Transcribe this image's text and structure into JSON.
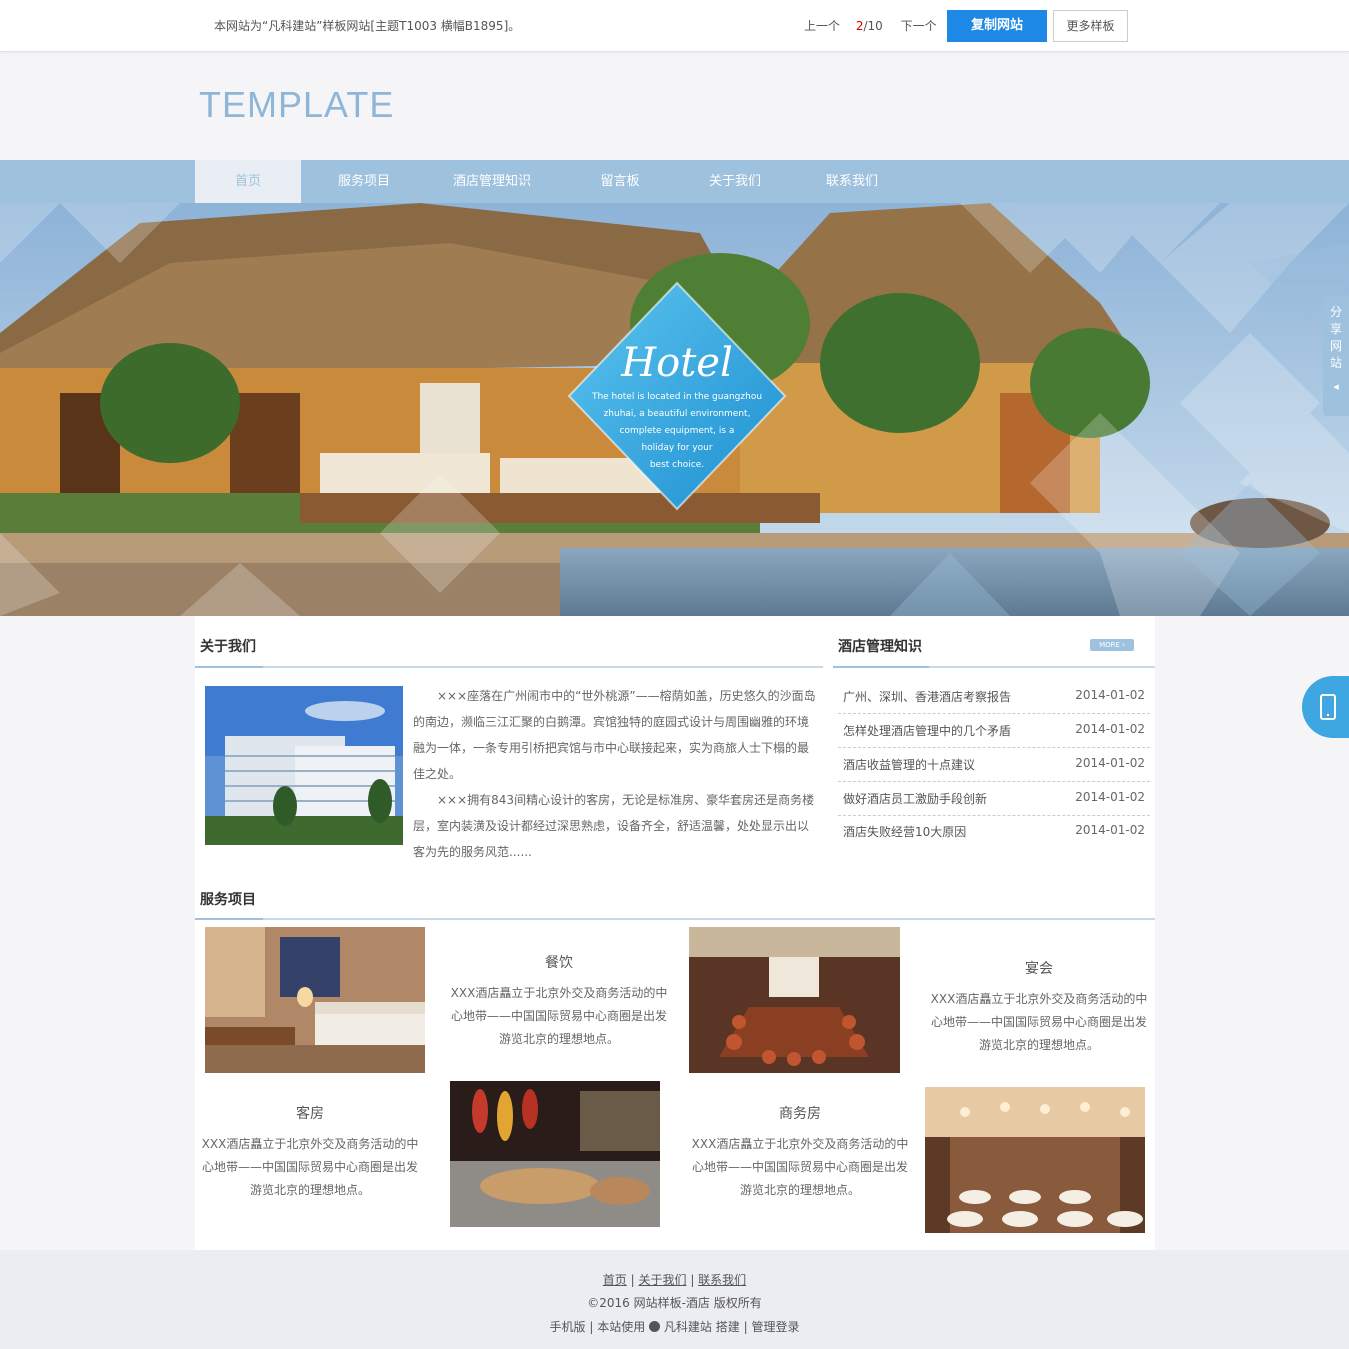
{
  "topbar": {
    "notice": "本网站为“凡科建站”样板网站[主题T1003 横幅B1895]。",
    "prev": "上一个",
    "page_current": "2",
    "page_total": "/10",
    "next": "下一个",
    "copy_btn": "复制网站",
    "more_btn": "更多样板"
  },
  "logo": "TEMPLATE",
  "nav": [
    "首页",
    "服务项目",
    "酒店管理知识",
    "留言板",
    "关于我们",
    "联系我们"
  ],
  "banner": {
    "badge_title": "Hotel",
    "badge_lines": [
      "The hotel is located in the guangzhou",
      "zhuhai, a beautiful environment,",
      "complete equipment, is a",
      "holiday for your",
      "best choice."
    ]
  },
  "share_label": "分享网站",
  "about": {
    "title": "关于我们",
    "p1": "×××座落在广州闹市中的“世外桃源”——榕荫如盖，历史悠久的沙面岛的南边，濒临三江汇聚的白鹅潭。宾馆独特的庭园式设计与周围幽雅的环境融为一体，一条专用引桥把宾馆与市中心联接起来，实为商旅人士下榻的最佳之处。",
    "p2": "×××拥有843间精心设计的客房，无论是标准房、豪华套房还是商务楼层，室内装潢及设计都经过深思熟虑，设备齐全，舒适温馨，处处显示出以客为先的服务风范......"
  },
  "news": {
    "title": "酒店管理知识",
    "more": "MORE ›",
    "items": [
      {
        "title": "广州、深圳、香港酒店考察报告",
        "date": "2014-01-02"
      },
      {
        "title": "怎样处理酒店管理中的几个矛盾",
        "date": "2014-01-02"
      },
      {
        "title": "酒店收益管理的十点建议",
        "date": "2014-01-02"
      },
      {
        "title": "做好酒店员工激励手段创新",
        "date": "2014-01-02"
      },
      {
        "title": "酒店失败经营10大原因",
        "date": "2014-01-02"
      }
    ]
  },
  "services": {
    "title": "服务项目",
    "items": [
      {
        "name": "餐饮",
        "desc": "XXX酒店矗立于北京外交及商务活动的中心地带——中国国际贸易中心商圈是出发游览北京的理想地点。"
      },
      {
        "name": "宴会",
        "desc": "XXX酒店矗立于北京外交及商务活动的中心地带——中国国际贸易中心商圈是出发游览北京的理想地点。"
      },
      {
        "name": "客房",
        "desc": "XXX酒店矗立于北京外交及商务活动的中心地带——中国国际贸易中心商圈是出发游览北京的理想地点。"
      },
      {
        "name": "商务房",
        "desc": "XXX酒店矗立于北京外交及商务活动的中心地带——中国国际贸易中心商圈是出发游览北京的理想地点。"
      }
    ]
  },
  "footer": {
    "links": [
      "首页",
      "关于我们",
      "联系我们"
    ],
    "copyright": "©2016 网站样板-酒店 版权所有",
    "mobile": "手机版",
    "powered_prefix": "本站使用",
    "powered_brand": "凡科建站",
    "powered_suffix": "搭建",
    "admin": "管理登录"
  },
  "colors": {
    "nav_bg": "#9ec1dd",
    "accent_blue": "#1e88e5",
    "logo": "#8fb6d8",
    "footer_bg": "#ecedf2"
  }
}
